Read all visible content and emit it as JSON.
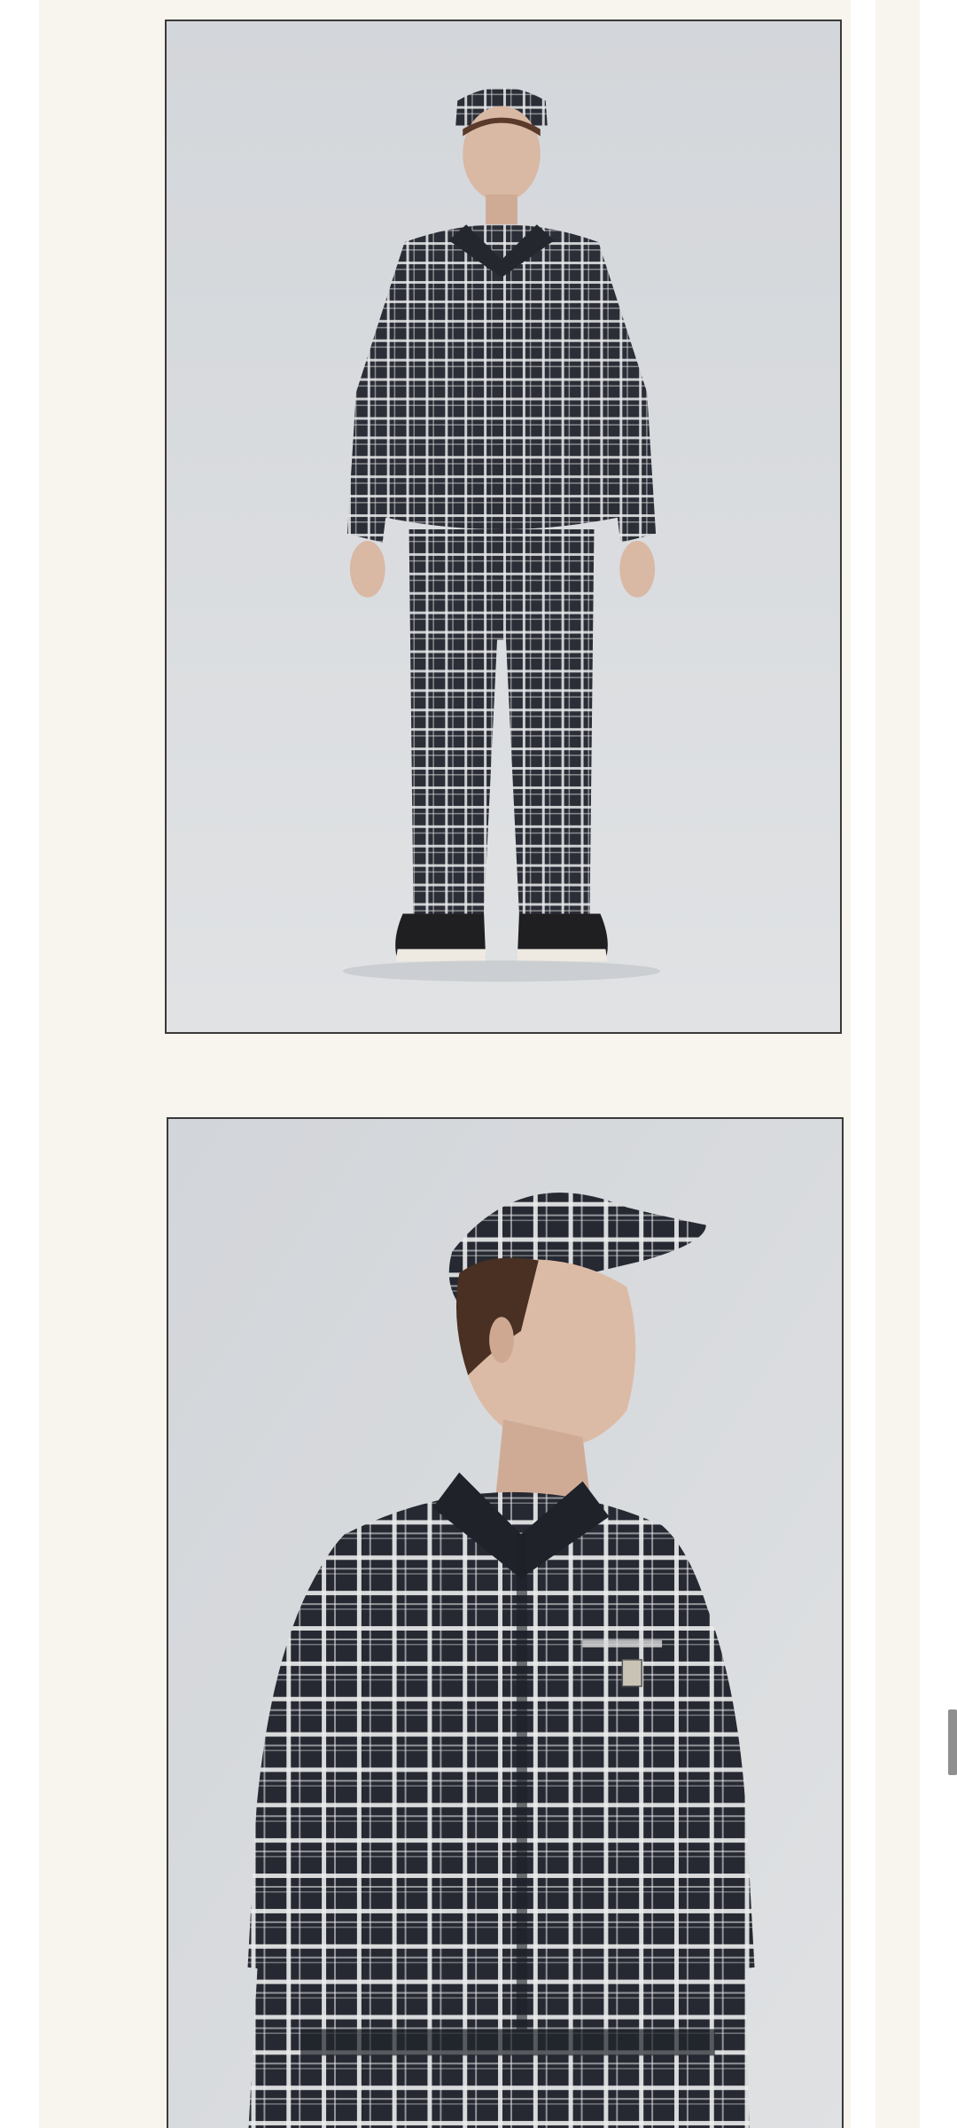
{
  "colors": {
    "panel_background": "#f8f5ee",
    "photo_backdrop": "#d5d8dc",
    "frame_border": "#3a3a3a",
    "plaid_dark": "#2b2e36",
    "plaid_light": "#e9eaec",
    "scroll_indicator": "#8f8f8f"
  },
  "gallery": {
    "images": [
      {
        "name": "model-full-body-plaid-set-photo"
      },
      {
        "name": "model-half-body-plaid-shirt-cap-photo"
      }
    ]
  }
}
